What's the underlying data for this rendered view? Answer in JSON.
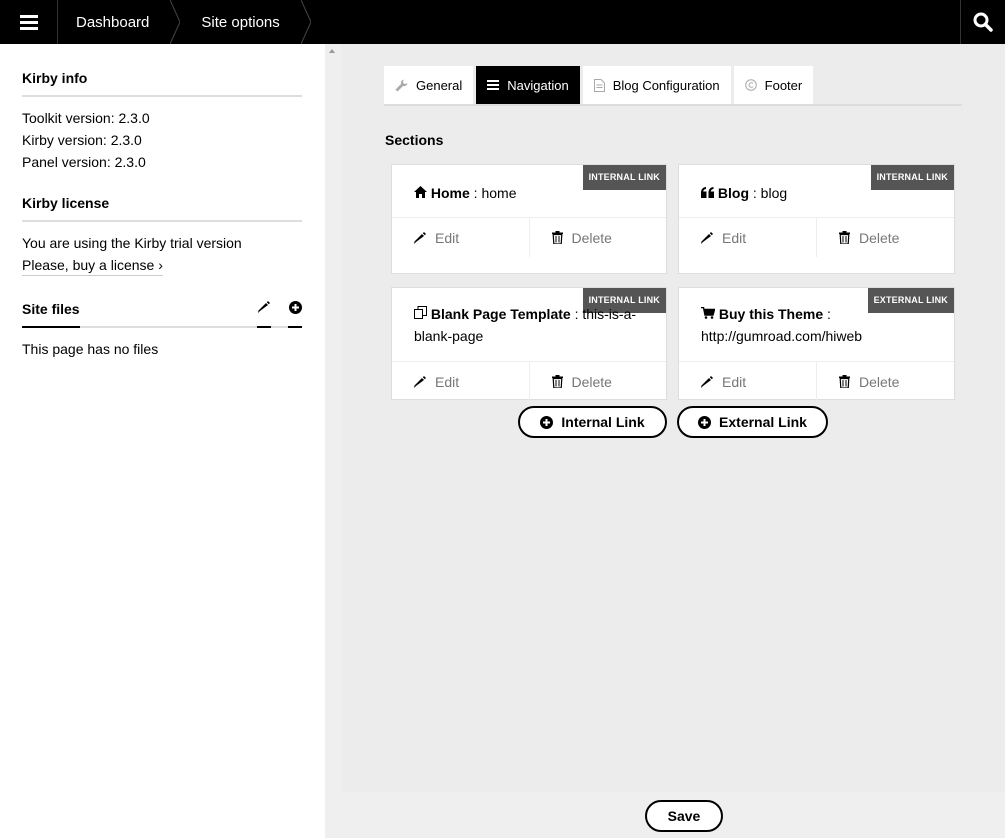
{
  "topbar": {
    "menu_icon": "hamburger-icon",
    "breadcrumbs": [
      "Dashboard",
      "Site options"
    ],
    "search_icon": "search-icon"
  },
  "sidebar": {
    "info_title": "Kirby info",
    "info_lines": [
      "Toolkit version: 2.3.0",
      "Kirby version: 2.3.0",
      "Panel version: 2.3.0"
    ],
    "license_title": "Kirby license",
    "license_text": "You are using the Kirby trial version",
    "license_link": "Please, buy a license ›",
    "files_title": "Site files",
    "no_files": "This page has no files"
  },
  "tabs": [
    {
      "label": "General",
      "icon": "wrench-icon"
    },
    {
      "label": "Navigation",
      "icon": "list-icon",
      "active": true
    },
    {
      "label": "Blog Configuration",
      "icon": "document-icon"
    },
    {
      "label": "Footer",
      "icon": "copyright-icon"
    }
  ],
  "sections_label": "Sections",
  "cards": [
    {
      "icon": "home-icon",
      "name": "Home",
      "sep": " : ",
      "value": "home",
      "badge": "Internal link",
      "edit": "Edit",
      "delete": "Delete"
    },
    {
      "icon": "quote-icon",
      "name": "Blog",
      "sep": " : ",
      "value": "blog",
      "badge": "Internal link",
      "edit": "Edit",
      "delete": "Delete"
    },
    {
      "icon": "copy-icon",
      "name": "Blank Page Template",
      "sep": " : ",
      "value": "this-is-a-blank-page",
      "badge": "Internal link",
      "edit": "Edit",
      "delete": "Delete"
    },
    {
      "icon": "cart-icon",
      "name": "Buy this Theme",
      "sep": " : ",
      "value": "http://gumroad.com/hiweb",
      "badge": "External link",
      "edit": "Edit",
      "delete": "Delete"
    }
  ],
  "add_buttons": {
    "internal": "Internal Link",
    "external": "External Link"
  },
  "save_label": "Save"
}
